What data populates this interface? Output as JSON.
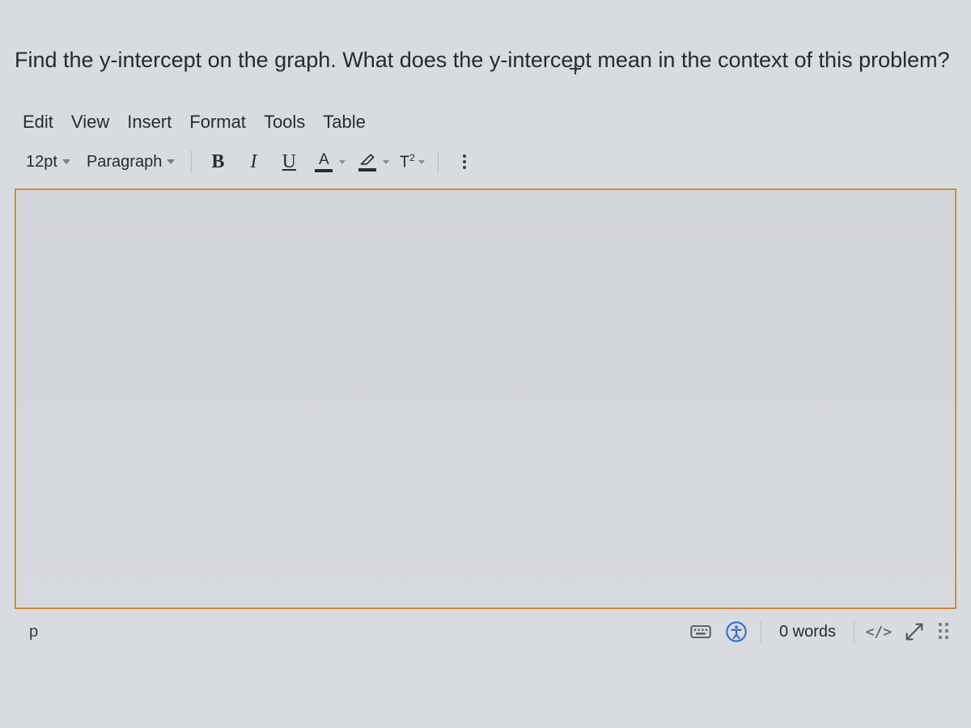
{
  "prompt": {
    "text": "Find the y-intercept on the graph. What does the y-intercept mean in the context of this problem?"
  },
  "menubar": {
    "items": [
      "Edit",
      "View",
      "Insert",
      "Format",
      "Tools",
      "Table"
    ]
  },
  "toolbar": {
    "font_size_label": "12pt",
    "paragraph_label": "Paragraph",
    "bold_label": "B",
    "italic_label": "I",
    "underline_label": "U",
    "textcolor_label": "A",
    "superscript_label_T": "T",
    "superscript_label_exp": "2"
  },
  "statusbar": {
    "element_path": "p",
    "word_count": "0 words",
    "code_label": "</>"
  }
}
